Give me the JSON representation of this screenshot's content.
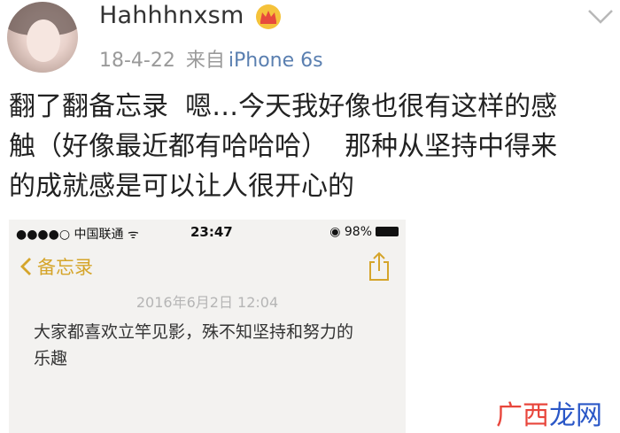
{
  "post": {
    "username": "Hahhhnxsm",
    "date": "18-4-22",
    "from_label": "来自",
    "source": "iPhone 6s",
    "text": "翻了翻备忘录  嗯…今天我好像也很有这样的感\n触（好像最近都有哈哈哈）  那种从坚持中得来\n的成就感是可以让人很开心的"
  },
  "screenshot": {
    "carrier": "●●●●○ 中国联通 ᯤ",
    "time": "23:47",
    "battery": "98%",
    "back_label": "备忘录",
    "note_date": "2016年6月2日  12:04",
    "note_text": "大家都喜欢立竿见影，殊不知坚持和努力的\n乐趣"
  },
  "watermark": {
    "part1": "广西",
    "part2": "龙网"
  },
  "icons": [
    "crown-icon",
    "chevron-down-icon",
    "back-chevron-icon",
    "share-icon"
  ],
  "colors": {
    "accent_yellow": "#d5a52b",
    "link_blue": "#5a7fb0",
    "watermark_red": "#e8463c",
    "watermark_blue": "#2a57c7"
  }
}
